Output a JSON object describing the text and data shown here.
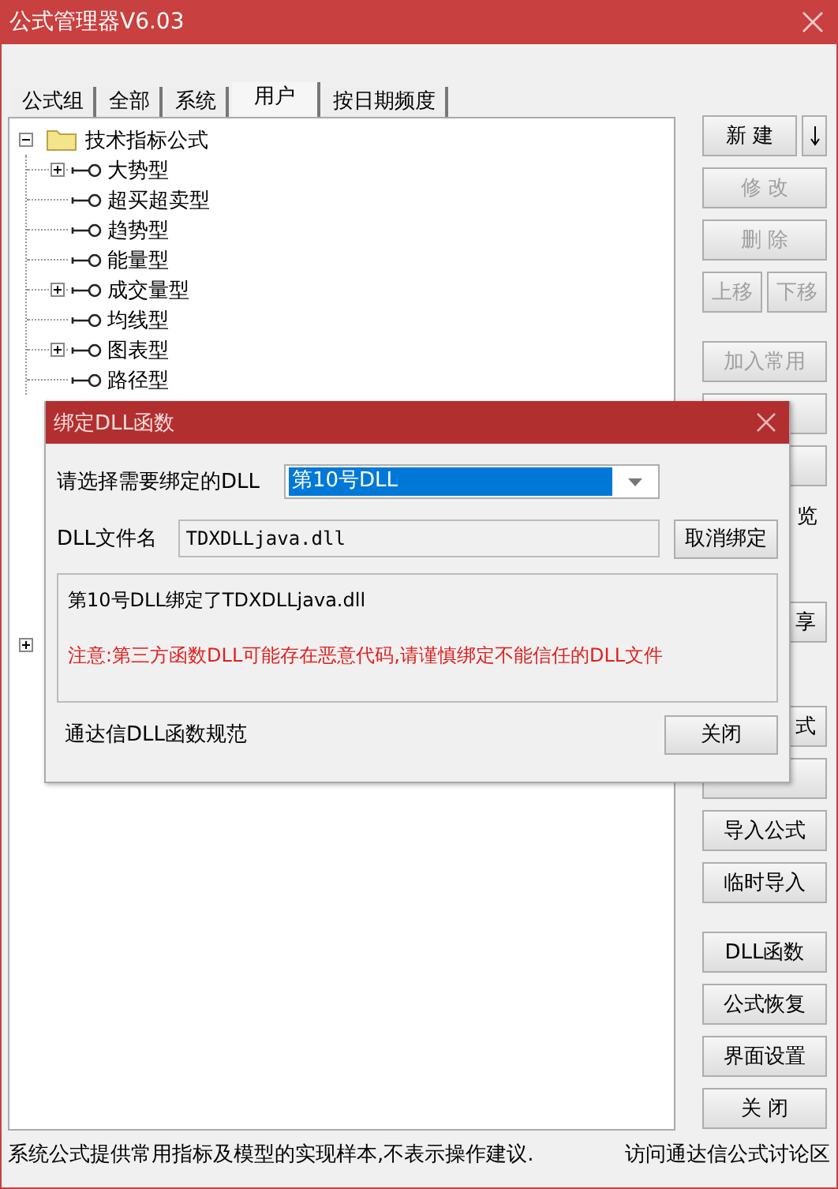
{
  "window": {
    "title": "公式管理器V6.03"
  },
  "tabs": [
    {
      "label": "公式组",
      "selected": false
    },
    {
      "label": "全部",
      "selected": false
    },
    {
      "label": "系统",
      "selected": false
    },
    {
      "label": "用户",
      "selected": true
    },
    {
      "label": "按日期频度",
      "selected": false
    }
  ],
  "tree": [
    {
      "label": "技术指标公式",
      "expanded": true,
      "children": [
        {
          "label": "大势型",
          "expanded": false
        },
        {
          "label": "超买超卖型"
        },
        {
          "label": "趋势型"
        },
        {
          "label": "能量型"
        },
        {
          "label": "成交量型",
          "expanded": false
        },
        {
          "label": "均线型"
        },
        {
          "label": "图表型",
          "expanded": false
        },
        {
          "label": "路径型"
        }
      ]
    },
    {
      "expanded": false
    }
  ],
  "button_groups": [
    [
      {
        "kind": "split",
        "label": "新 建",
        "disabled": false
      },
      {
        "kind": "button",
        "label": "修 改",
        "disabled": true
      },
      {
        "kind": "button",
        "label": "删 除",
        "disabled": true
      },
      {
        "kind": "pair",
        "labels": [
          "上移",
          "下移"
        ],
        "disabled": true
      }
    ],
    [
      {
        "kind": "button",
        "label": "加入常用",
        "disabled": true
      },
      {
        "kind": "button"
      },
      {
        "kind": "button"
      },
      {
        "kind": "label",
        "label": "览"
      },
      {
        "kind": "button",
        "label": "享",
        "disabled": false
      },
      {
        "kind": "button",
        "label": "式",
        "disabled": false
      },
      {
        "kind": "button"
      },
      {
        "kind": "button",
        "label": "导入公式",
        "disabled": false
      },
      {
        "kind": "button",
        "label": "临时导入",
        "disabled": false
      }
    ],
    [
      {
        "kind": "button",
        "label": "DLL函数",
        "disabled": false
      },
      {
        "kind": "button",
        "label": "公式恢复",
        "disabled": false
      },
      {
        "kind": "button",
        "label": "界面设置",
        "disabled": false
      },
      {
        "kind": "button",
        "label": "关 闭",
        "disabled": false
      }
    ]
  ],
  "status_bar": {
    "note": "系统公式提供常用指标及模型的实现样本,不表示操作建议.",
    "link": "访问通达信公式讨论区"
  },
  "dialog": {
    "title": "绑定DLL函数",
    "select_label": "请选择需要绑定的DLL",
    "select_value": "第10号DLL",
    "file_label": "DLL文件名",
    "file_value": "TDXDLLjava.dll",
    "unbind_button": "取消绑定",
    "info": "第10号DLL绑定了TDXDLLjava.dll",
    "warning": "注意:第三方函数DLL可能存在恶意代码,请谨慎绑定不能信任的DLL文件",
    "spec_link": "通达信DLL函数规范",
    "close_button": "关闭"
  }
}
